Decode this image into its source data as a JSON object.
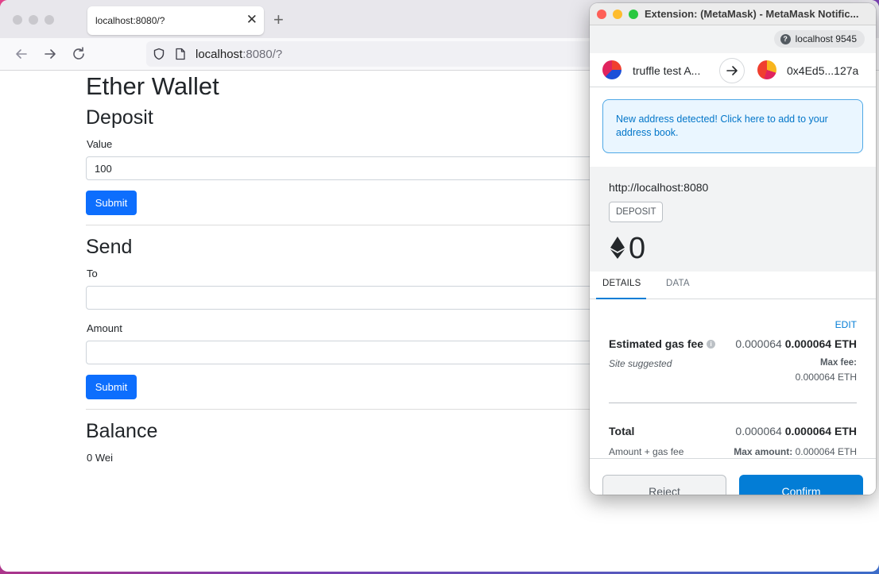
{
  "browser": {
    "tab_title": "localhost:8080/?",
    "tab_close": "✕",
    "new_tab": "+",
    "url_host": "localhost",
    "url_rest": ":8080/?"
  },
  "page": {
    "title": "Ether Wallet",
    "deposit": {
      "heading": "Deposit",
      "value_label": "Value",
      "value": "100",
      "submit_label": "Submit"
    },
    "send": {
      "heading": "Send",
      "to_label": "To",
      "to_value": "",
      "amount_label": "Amount",
      "amount_value": "",
      "submit_label": "Submit"
    },
    "balance": {
      "heading": "Balance",
      "value": "0 Wei"
    }
  },
  "metamask": {
    "window_title": "Extension: (MetaMask) - MetaMask Notific...",
    "origin_help": "?",
    "network": "localhost 9545",
    "from_account": "truffle test A...",
    "to_account": "0x4Ed5...127a",
    "alert": "New address detected! Click here to add to your address book.",
    "site": "http://localhost:8080",
    "method": "DEPOSIT",
    "amount": "0",
    "tabs": [
      "DETAILS",
      "DATA"
    ],
    "edit_label": "EDIT",
    "gas": {
      "label": "Estimated gas fee",
      "info": "i",
      "secondary": "0.000064",
      "primary": "0.000064 ETH",
      "suggested": "Site suggested",
      "max_fee_label": "Max fee:",
      "max_fee_value": "0.000064 ETH"
    },
    "total": {
      "label": "Total",
      "secondary": "0.000064",
      "primary": "0.000064 ETH",
      "sub_label": "Amount + gas fee",
      "max_amount_label": "Max amount:",
      "max_amount_value": "0.000064 ETH"
    },
    "reject_label": "Reject",
    "confirm_label": "Confirm"
  },
  "colors": {
    "bootstrap_primary": "#0d6efd",
    "metamask_blue": "#037dd6"
  }
}
